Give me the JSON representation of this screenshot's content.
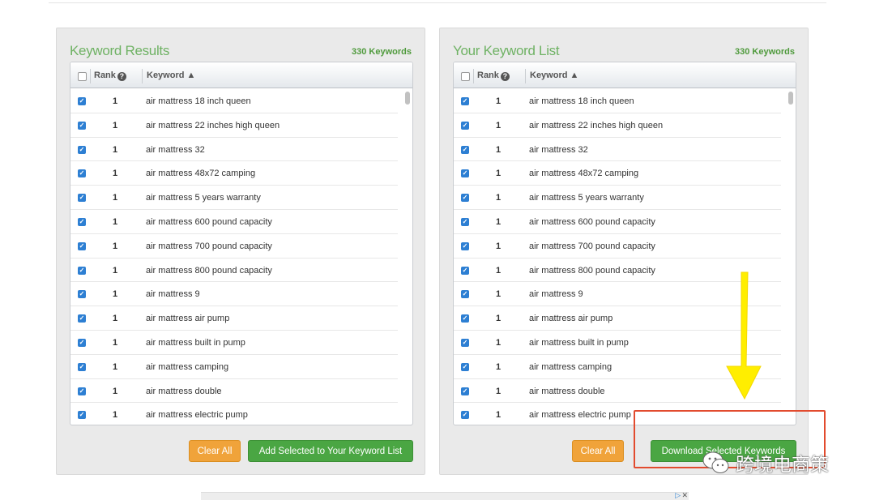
{
  "left_panel": {
    "title": "Keyword Results",
    "count": "330 Keywords",
    "headers": {
      "rank": "Rank",
      "keyword": "Keyword"
    },
    "buttons": {
      "clear": "Clear All",
      "action": "Add Selected to Your Keyword List"
    }
  },
  "right_panel": {
    "title": "Your Keyword List",
    "count": "330 Keywords",
    "headers": {
      "rank": "Rank",
      "keyword": "Keyword"
    },
    "buttons": {
      "clear": "Clear All",
      "action": "Download Selected Keywords"
    }
  },
  "rows": [
    {
      "rank": "1",
      "keyword": "air mattress 18 inch queen"
    },
    {
      "rank": "1",
      "keyword": "air mattress 22 inches high queen"
    },
    {
      "rank": "1",
      "keyword": "air mattress 32"
    },
    {
      "rank": "1",
      "keyword": "air mattress 48x72 camping"
    },
    {
      "rank": "1",
      "keyword": "air mattress 5 years warranty"
    },
    {
      "rank": "1",
      "keyword": "air mattress 600 pound capacity"
    },
    {
      "rank": "1",
      "keyword": "air mattress 700 pound capacity"
    },
    {
      "rank": "1",
      "keyword": "air mattress 800 pound capacity"
    },
    {
      "rank": "1",
      "keyword": "air mattress 9"
    },
    {
      "rank": "1",
      "keyword": "air mattress air pump"
    },
    {
      "rank": "1",
      "keyword": "air mattress built in pump"
    },
    {
      "rank": "1",
      "keyword": "air mattress camping"
    },
    {
      "rank": "1",
      "keyword": "air mattress double"
    },
    {
      "rank": "1",
      "keyword": "air mattress electric pump"
    }
  ],
  "watermark": {
    "text": "跨境电商策"
  },
  "colors": {
    "accent_green": "#4aa643",
    "clear_orange": "#f0a33a",
    "highlight_red": "#e24b2e",
    "arrow_yellow": "#ffee00"
  }
}
